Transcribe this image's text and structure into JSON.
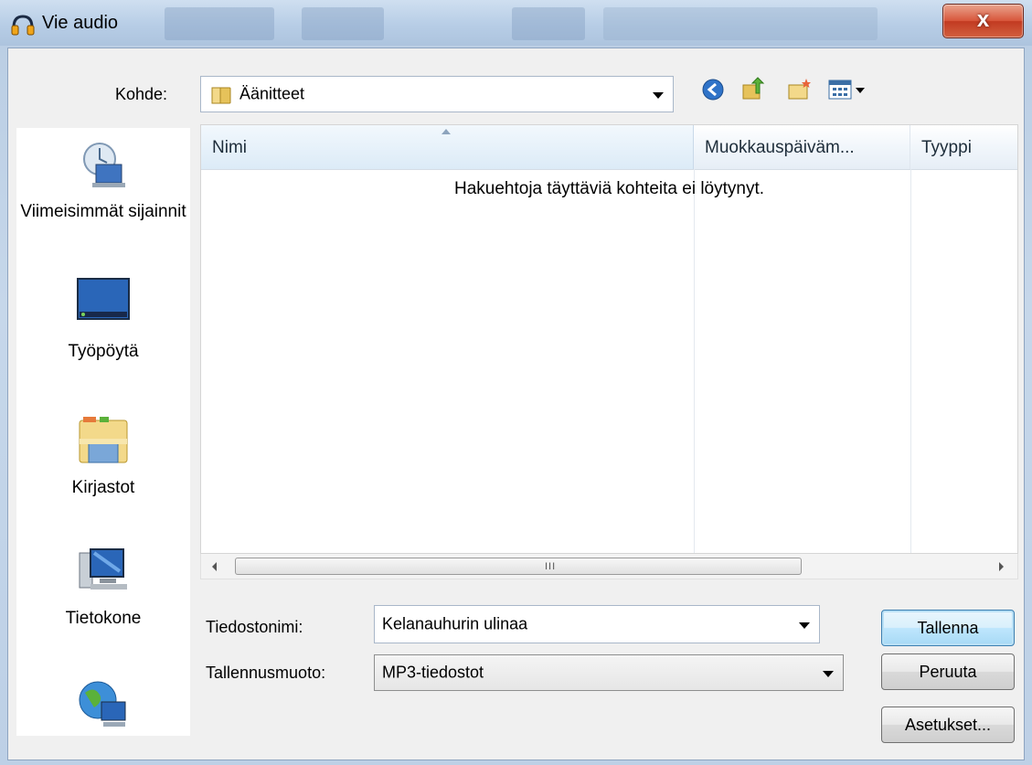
{
  "window": {
    "title": "Vie audio",
    "close_symbol": "x"
  },
  "location": {
    "label": "Kohde:",
    "value": "Äänitteet"
  },
  "places": [
    {
      "label": "Viimeisimmät sijainnit",
      "icon": "recent-places-icon"
    },
    {
      "label": "Työpöytä",
      "icon": "desktop-icon"
    },
    {
      "label": "Kirjastot",
      "icon": "libraries-icon"
    },
    {
      "label": "Tietokone",
      "icon": "computer-icon"
    },
    {
      "label": "",
      "icon": "network-icon"
    }
  ],
  "file_list": {
    "columns": [
      {
        "label": "Nimi"
      },
      {
        "label": "Muokkauspäiväm..."
      },
      {
        "label": "Tyyppi"
      }
    ],
    "empty_message": "Hakuehtoja täyttäviä kohteita ei löytynyt.",
    "scroll_grip": "III"
  },
  "filename": {
    "label": "Tiedostonimi:",
    "value": "Kelanauhurin ulinaa"
  },
  "format": {
    "label": "Tallennusmuoto:",
    "value": "MP3-tiedostot"
  },
  "buttons": {
    "save": "Tallenna",
    "cancel": "Peruuta",
    "options": "Asetukset..."
  },
  "colors": {
    "close_button": "#d24b2f",
    "default_button_border": "#3c7fb1",
    "window_frame": "#b9cde3"
  }
}
